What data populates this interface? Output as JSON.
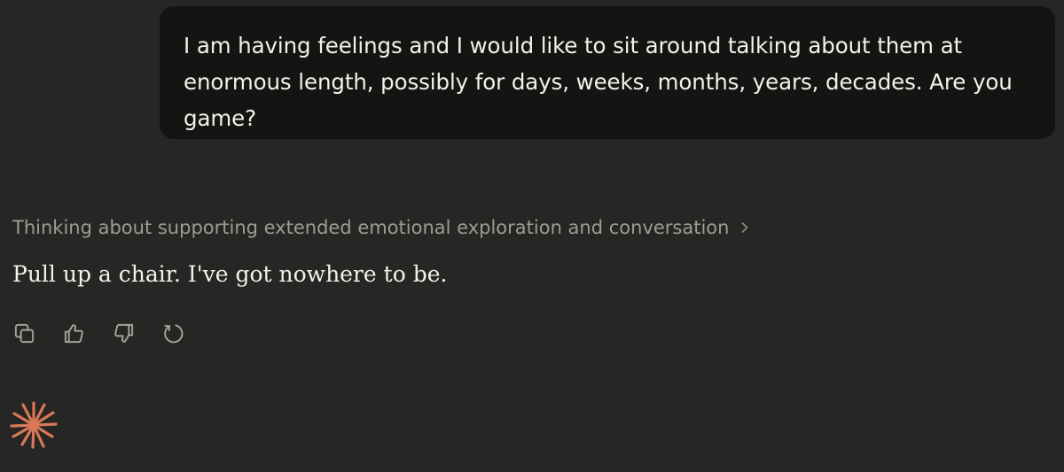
{
  "conversation": {
    "user_message": "I am having feelings and I would like to sit around talking about them at enormous length, possibly for days, weeks, months, years, decades. Are you game?",
    "thinking_summary": "Thinking about supporting extended emotional exploration and conversation",
    "assistant_reply": "Pull up a chair. I've got nowhere to be."
  },
  "icons": {
    "thinking_toggle": "chevron-right-icon",
    "actions": [
      "copy-icon",
      "thumbs-up-icon",
      "thumbs-down-icon",
      "retry-icon"
    ],
    "brand": "spark-icon"
  },
  "colors": {
    "background": "#262624",
    "user_bubble": "#141413",
    "text_primary": "#f3f1ea",
    "text_secondary": "#9e9b93",
    "accent": "#d97757"
  }
}
